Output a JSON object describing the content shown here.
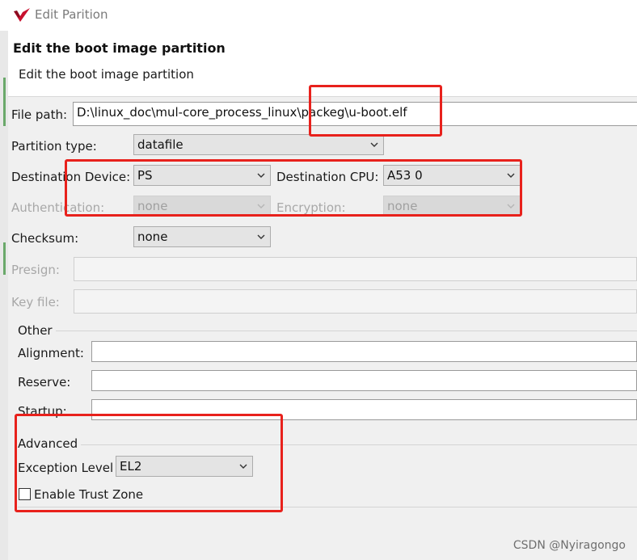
{
  "window": {
    "title": "Edit Parition"
  },
  "header": {
    "title": "Edit the boot image partition",
    "description": "Edit the boot image partition"
  },
  "form": {
    "file_path_label": "File path:",
    "file_path_value": "D:\\linux_doc\\mul-core_process_linux\\packeg\\u-boot.elf",
    "partition_type_label": "Partition type:",
    "partition_type_value": "datafile",
    "destination_device_label": "Destination Device:",
    "destination_device_value": "PS",
    "destination_cpu_label": "Destination CPU:",
    "destination_cpu_value": "A53 0",
    "authentication_label": "Authentication:",
    "authentication_value": "none",
    "encryption_label": "Encryption:",
    "encryption_value": "none",
    "checksum_label": "Checksum:",
    "checksum_value": "none",
    "presign_label": "Presign:",
    "key_file_label": "Key file:"
  },
  "other": {
    "title": "Other",
    "alignment_label": "Alignment:",
    "reserve_label": "Reserve:",
    "startup_label": "Startup:"
  },
  "advanced": {
    "title": "Advanced",
    "exception_level_label": "Exception Level",
    "exception_level_value": "EL2",
    "trust_zone_label": "Enable Trust Zone",
    "trust_zone_checked": false
  },
  "watermark": "CSDN @Nyiragongo",
  "colors": {
    "annotation_red": "#e8211c",
    "logo_red": "#c8102e"
  }
}
